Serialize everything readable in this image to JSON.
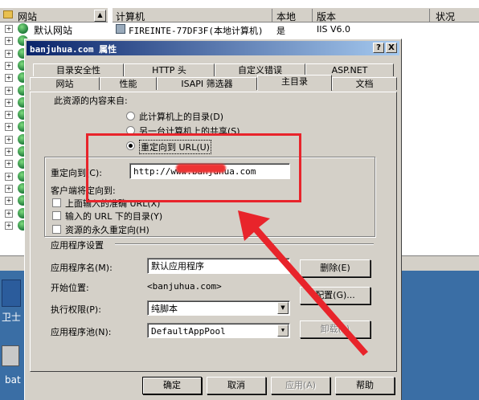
{
  "tree": {
    "header": "网站",
    "site_label": "默认网站"
  },
  "list": {
    "columns": [
      "计算机",
      "本地",
      "版本",
      "状况"
    ],
    "row": {
      "computer": "FIREINTE-77DF3F(本地计算机)",
      "local": "是",
      "version": "IIS V6.0",
      "status": ""
    }
  },
  "desktop": {
    "label1": "卫士",
    "label2": "bat"
  },
  "dialog": {
    "title": "banjuhua.com 属性",
    "help_btn": "?",
    "close_btn": "X",
    "tabs_row1": [
      "目录安全性",
      "HTTP 头",
      "自定义错误",
      "ASP.NET"
    ],
    "tabs_row2": [
      "网站",
      "性能",
      "ISAPI 筛选器",
      "主目录",
      "文档"
    ],
    "content_source_label": "此资源的内容来自:",
    "radio_options": [
      {
        "label": "此计算机上的目录(D)",
        "selected": false
      },
      {
        "label": "另一台计算机上的共享(S)",
        "selected": false
      },
      {
        "label": "重定向到 URL(U)",
        "selected": true
      }
    ],
    "redirect_label": "重定向到(C):",
    "redirect_value": "http://www.banjuhua.com",
    "client_label": "客户端将定向到:",
    "checkboxes": [
      {
        "label": "上面输入的准确 URL(X)",
        "checked": false
      },
      {
        "label": "输入的 URL 下的目录(Y)",
        "checked": false
      },
      {
        "label": "资源的永久重定向(H)",
        "checked": false
      }
    ],
    "app_settings_label": "应用程序设置",
    "app_name_label": "应用程序名(M):",
    "app_name_value": "默认应用程序",
    "start_point_label": "开始位置:",
    "start_point_value": "<banjuhua.com>",
    "exec_perm_label": "执行权限(P):",
    "exec_perm_value": "纯脚本",
    "app_pool_label": "应用程序池(N):",
    "app_pool_value": "DefaultAppPool",
    "delete_btn": "删除(E)",
    "config_btn": "配置(G)...",
    "unload_btn": "卸载(L)",
    "ok_btn": "确定",
    "cancel_btn": "取消",
    "apply_btn": "应用(A)",
    "help_button": "帮助"
  },
  "annotation_color": "#e8242b"
}
